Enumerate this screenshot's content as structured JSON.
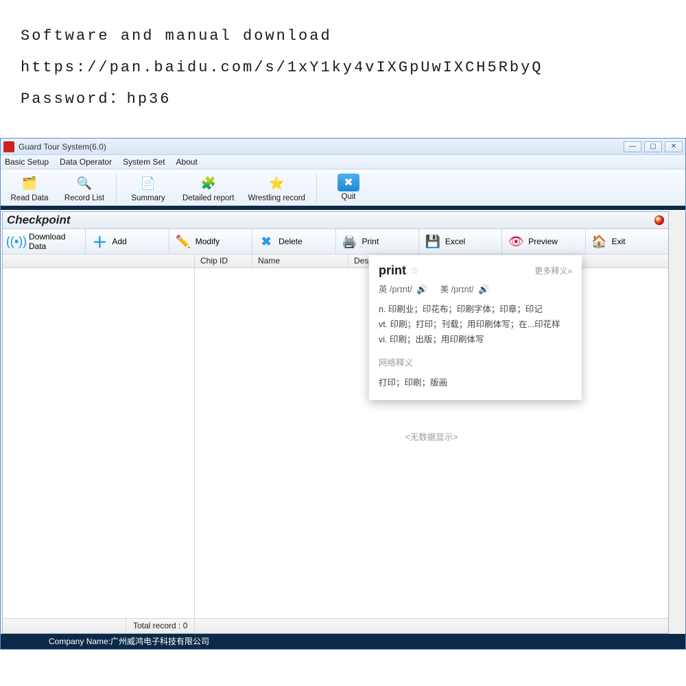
{
  "header": {
    "line1": "Software and manual download",
    "line2": "https://pan.baidu.com/s/1xY1ky4vIXGpUwIXCH5RbyQ",
    "line3": "Password：hp36"
  },
  "window": {
    "title": "Guard Tour System(6.0)",
    "controls": {
      "min": "—",
      "max": "▢",
      "close": "✕"
    }
  },
  "menu": {
    "basic_setup": "Basic Setup",
    "data_operator": "Data Operator",
    "system_set": "System Set",
    "about": "About"
  },
  "toolbar": {
    "read_data": "Read Data",
    "record_list": "Record List",
    "summary": "Summary",
    "detailed_report": "Detailed report",
    "wrestling_record": "Wrestling record",
    "quit": "Quit"
  },
  "checkpoint": {
    "title": "Checkpoint",
    "buttons": {
      "download": "Download Data",
      "add": "Add",
      "modify": "Modify",
      "delete": "Delete",
      "print": "Print",
      "excel": "Excel",
      "preview": "Preview",
      "exit": "Exit"
    },
    "columns": {
      "chip_id": "Chip ID",
      "name": "Name",
      "desc": "Desc"
    },
    "no_data": "<无数据显示>",
    "status": {
      "total": "Total record : 0"
    }
  },
  "dictionary": {
    "word": "print",
    "more": "更多释义»",
    "uk_label": "英",
    "uk_pron": "/prɪnt/",
    "us_label": "美",
    "us_pron": "/prɪnt/",
    "def_n": "n. 印刷业；印花布；印刷字体；印章；印记",
    "def_vt": "vt. 印刷；打印；刊载；用印刷体写；在...印花样",
    "def_vi": "vi. 印刷；出版；用印刷体写",
    "net_label": "网络释义",
    "net_def": "打印；印刷；版画"
  },
  "footer": {
    "company": "Company Name:广州威鸿电子科技有限公司"
  }
}
